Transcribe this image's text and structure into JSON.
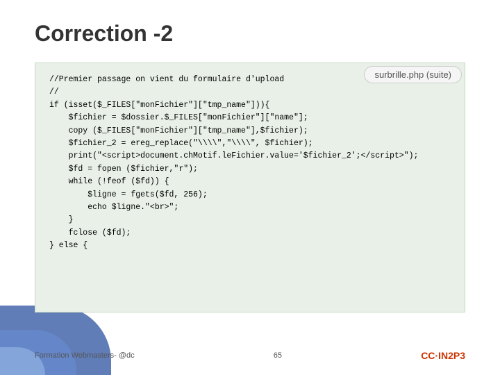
{
  "title": "Correction -2",
  "badge": "surbrille.php (suite)",
  "code": "//Premier passage on vient du formulaire d'upload\n//\nif (isset($_FILES[\"monFichier\"][\"tmp_name\"])){\n    $fichier = $dossier.$_FILES[\"monFichier\"][\"name\"];\n    copy ($_FILES[\"monFichier\"][\"tmp_name\"],$fichier);\n    $fichier_2 = ereg_replace(\"\\\\\\\\\",\"\\\\\\\\\", $fichier);\n    print(\"<script>document.chMotif.leFichier.value='$fichier_2';<\\/script>\");\n    $fd = fopen ($fichier,\"r\");\n    while (!feof ($fd)) {\n        $ligne = fgets($fd, 256);\n        echo $ligne.\"<br>\";\n    }\n    fclose ($fd);\n} else {",
  "footer": {
    "left": "Formation Webmasters- @dc",
    "center": "65",
    "right": "CC·IN2P3"
  }
}
